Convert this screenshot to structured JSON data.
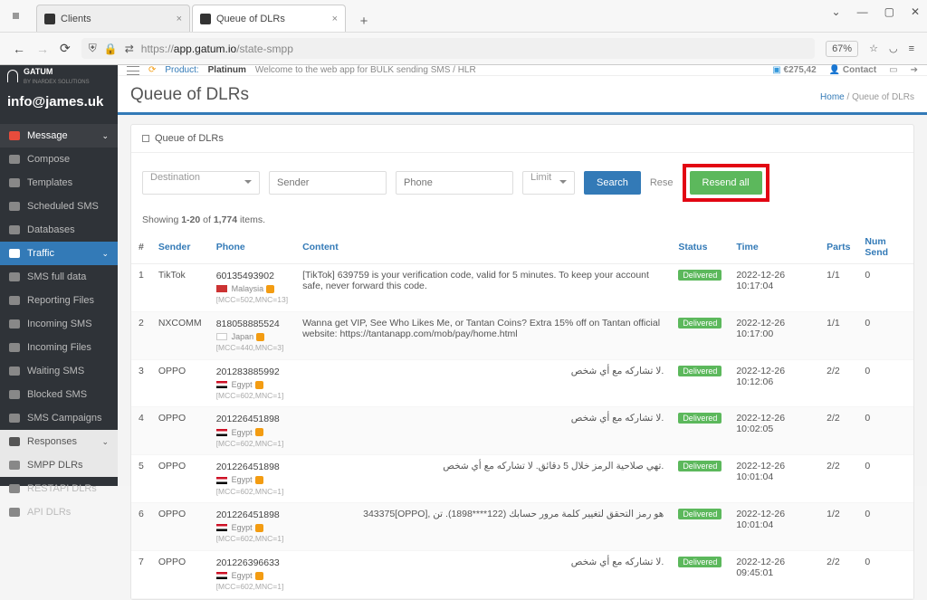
{
  "browser": {
    "tabs": [
      {
        "title": "Clients"
      },
      {
        "title": "Queue of DLRs"
      }
    ],
    "url_prefix": "https://",
    "url_host": "app.gatum.io",
    "url_path": "/state-smpp",
    "zoom": "67%",
    "win_min": "—",
    "win_max": "▢",
    "win_close": "✕",
    "chev": "⌄"
  },
  "sidebar": {
    "brand": "GATUM",
    "brand_sub": "BY INARDEX SOLUTIONS",
    "email": "info@james.uk",
    "items": {
      "message": "Message",
      "compose": "Compose",
      "templates": "Templates",
      "scheduled": "Scheduled SMS",
      "databases": "Databases",
      "traffic": "Traffic",
      "smsfull": "SMS full data",
      "reporting": "Reporting Files",
      "incomingsms": "Incoming SMS",
      "incomingfiles": "Incoming Files",
      "waiting": "Waiting SMS",
      "blocked": "Blocked SMS",
      "campaigns": "SMS Campaigns",
      "responses": "Responses",
      "smpp": "SMPP DLRs",
      "restapi": "RESTAPI DLRs",
      "apidlrs": "API DLRs"
    }
  },
  "topbar": {
    "product_label": "Product:",
    "product_value": "Platinum",
    "welcome": "Welcome to the web app for BULK sending SMS / HLR",
    "balance": "€275,42",
    "contact": "Contact"
  },
  "page": {
    "title": "Queue of DLRs",
    "bc_home": "Home",
    "bc_sep": " / ",
    "bc_current": "Queue of DLRs",
    "panel_title": "Queue of DLRs"
  },
  "filters": {
    "destination": "Destination",
    "sender": "Sender",
    "phone": "Phone",
    "limit": "Limit",
    "search": "Search",
    "resend_trunc": "Rese",
    "resend_all": "Resend all"
  },
  "summary": {
    "p1": "Showing ",
    "b1": "1-20",
    "p2": " of ",
    "b2": "1,774",
    "p3": " items."
  },
  "columns": {
    "idx": "#",
    "sender": "Sender",
    "phone": "Phone",
    "content": "Content",
    "status": "Status",
    "time": "Time",
    "parts": "Parts",
    "numsend": "Num Send"
  },
  "rows": [
    {
      "idx": "1",
      "sender": "TikTok",
      "phone": "60135493902",
      "flag_class": "my",
      "country": "Malaysia",
      "operator": "…",
      "mcc": "[MCC=502,MNC=13]",
      "content": "[TikTok] 639759 is your verification code, valid for 5 minutes. To keep your account safe, never forward this code.",
      "rtl": false,
      "status": "Delivered",
      "time": "2022-12-26 10:17:04",
      "parts": "1/1",
      "numsend": "0"
    },
    {
      "idx": "2",
      "sender": "NXCOMM",
      "phone": "818058885524",
      "flag_class": "jp",
      "country": "Japan",
      "operator": "…",
      "mcc": "[MCC=440,MNC=3]",
      "content": "Wanna get VIP, See Who Likes Me, or Tantan Coins? Extra 15% off on Tantan official website: https://tantanapp.com/mob/pay/home.html",
      "rtl": false,
      "status": "Delivered",
      "time": "2022-12-26 10:17:00",
      "parts": "1/1",
      "numsend": "0"
    },
    {
      "idx": "3",
      "sender": "OPPO",
      "phone": "201283885992",
      "flag_class": "eg",
      "country": "Egypt",
      "operator": "",
      "mcc": "[MCC=602,MNC=1]",
      "content": ".لا تشاركه مع أي شخص",
      "rtl": true,
      "status": "Delivered",
      "time": "2022-12-26 10:12:06",
      "parts": "2/2",
      "numsend": "0"
    },
    {
      "idx": "4",
      "sender": "OPPO",
      "phone": "201226451898",
      "flag_class": "eg",
      "country": "Egypt",
      "operator": "",
      "mcc": "[MCC=602,MNC=1]",
      "content": ".لا تشاركه مع أي شخص",
      "rtl": true,
      "status": "Delivered",
      "time": "2022-12-26 10:02:05",
      "parts": "2/2",
      "numsend": "0"
    },
    {
      "idx": "5",
      "sender": "OPPO",
      "phone": "201226451898",
      "flag_class": "eg",
      "country": "Egypt",
      "operator": "",
      "mcc": "[MCC=602,MNC=1]",
      "content": ".تهي صلاحية الرمز خلال 5 دقائق. لا تشاركه مع أي شخص",
      "rtl": true,
      "status": "Delivered",
      "time": "2022-12-26 10:01:04",
      "parts": "2/2",
      "numsend": "0"
    },
    {
      "idx": "6",
      "sender": "OPPO",
      "phone": "201226451898",
      "flag_class": "eg",
      "country": "Egypt",
      "operator": "",
      "mcc": "[MCC=602,MNC=1]",
      "content": "هو رمز التحقق لتغيير كلمة مرور حسابك (122****1898). تن ,[OPPO]343375",
      "rtl": true,
      "status": "Delivered",
      "time": "2022-12-26 10:01:04",
      "parts": "1/2",
      "numsend": "0"
    },
    {
      "idx": "7",
      "sender": "OPPO",
      "phone": "201226396633",
      "flag_class": "eg",
      "country": "Egypt",
      "operator": "",
      "mcc": "[MCC=602,MNC=1]",
      "content": ".لا تشاركه مع أي شخص",
      "rtl": true,
      "status": "Delivered",
      "time": "2022-12-26 09:45:01",
      "parts": "2/2",
      "numsend": "0"
    }
  ]
}
